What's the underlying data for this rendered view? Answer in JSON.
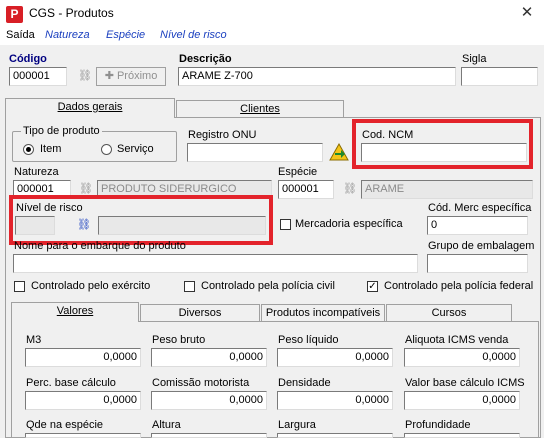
{
  "window": {
    "title": "CGS - Produtos",
    "icon_letter": "P",
    "close_glyph": "✕"
  },
  "menu": {
    "items": [
      "Saída",
      "Natureza",
      "Espécie",
      "Nível de risco"
    ]
  },
  "header": {
    "codigo_label": "Código",
    "codigo_value": "000001",
    "proximo_label": "Próximo",
    "descricao_label": "Descrição",
    "descricao_value": "ARAME Z-700",
    "sigla_label": "Sigla",
    "sigla_value": ""
  },
  "main_tabs": [
    "Dados gerais",
    "Clientes"
  ],
  "produto": {
    "tipo_label": "Tipo de produto",
    "item_label": "Item",
    "servico_label": "Serviço",
    "selected": "Item",
    "registro_onu_label": "Registro ONU",
    "registro_onu_value": "",
    "cod_ncm_label": "Cod. NCM",
    "cod_ncm_value": "",
    "natureza_label": "Natureza",
    "natureza_code": "000001",
    "natureza_desc": "PRODUTO SIDERURGICO",
    "especie_label": "Espécie",
    "especie_code": "000001",
    "especie_desc": "ARAME",
    "nivel_risco_label": "Nível de risco",
    "nivel_risco_code": "",
    "nivel_risco_desc": "",
    "mercadoria_label": "Mercadoria específica",
    "cod_merc_label": "Cód. Merc específica",
    "cod_merc_value": "0",
    "nome_embarque_label": "Nome para o embarque do produto",
    "nome_embarque_value": "",
    "grupo_embalagem_label": "Grupo de embalagem",
    "grupo_embalagem_value": "",
    "exercito_label": "Controlado pelo exército",
    "exercito_checked": false,
    "civil_label": "Controlado pela polícia civil",
    "civil_checked": false,
    "federal_label": "Controlado pela polícia federal",
    "federal_checked": true
  },
  "sub_tabs": [
    "Valores",
    "Diversos",
    "Produtos incompatíveis",
    "Cursos"
  ],
  "valores": [
    {
      "label": "M3",
      "value": "0,0000"
    },
    {
      "label": "Peso bruto",
      "value": "0,0000"
    },
    {
      "label": "Peso líquido",
      "value": "0,0000"
    },
    {
      "label": "Aliquota ICMS venda",
      "value": "0,0000"
    },
    {
      "label": "Perc. base cálculo",
      "value": "0,0000"
    },
    {
      "label": "Comissão motorista",
      "value": "0,0000"
    },
    {
      "label": "Densidade",
      "value": "0,0000"
    },
    {
      "label": "Valor base cálculo ICMS",
      "value": "0,0000"
    },
    {
      "label": "Qde na espécie",
      "value": ""
    },
    {
      "label": "Altura",
      "value": ""
    },
    {
      "label": "Largura",
      "value": ""
    },
    {
      "label": "Profundidade",
      "value": ""
    }
  ],
  "colors": {
    "highlight_border": "#e3232b",
    "label_blue": "#000080",
    "menu_blue": "#1a3fbf"
  }
}
